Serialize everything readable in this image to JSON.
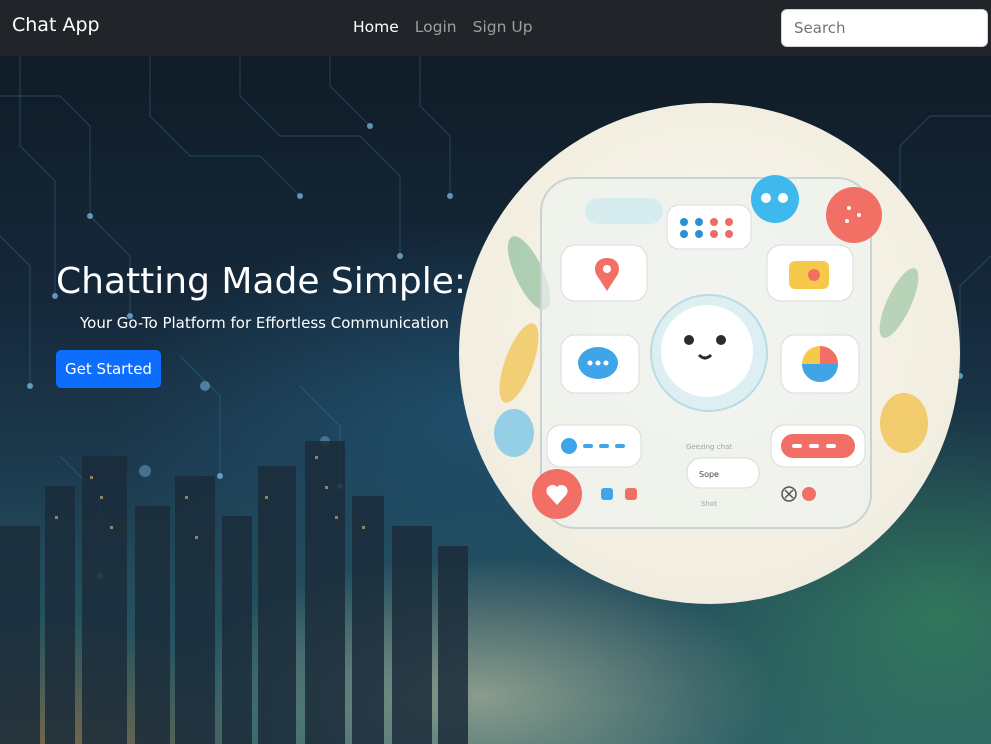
{
  "navbar": {
    "brand": "Chat App",
    "links": [
      {
        "label": "Home",
        "active": true
      },
      {
        "label": "Login",
        "active": false
      },
      {
        "label": "Sign Up",
        "active": false
      }
    ],
    "search_placeholder": "Search"
  },
  "hero": {
    "heading": "Chatting Made Simple:",
    "subheading": "Your Go-To Platform for Effortless Communication",
    "cta_label": "Get Started",
    "image_texts": {
      "panel_caption": "Geezing chat",
      "pill_label": "Sope",
      "footer_label": "Shot"
    }
  },
  "colors": {
    "navbar_bg": "#212529",
    "primary": "#0d6efd",
    "hero_text": "#ffffff"
  }
}
